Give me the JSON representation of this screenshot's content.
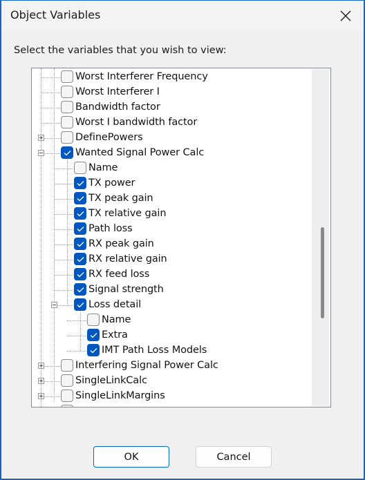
{
  "window": {
    "title": "Object Variables",
    "close_icon": "close-x-icon"
  },
  "prompt": "Select the variables that you wish to view:",
  "tree": {
    "rows": [
      {
        "label": "Worst Interferer Frequency",
        "level": 1,
        "checked": false,
        "expander": null
      },
      {
        "label": "Worst Interferer I",
        "level": 1,
        "checked": false,
        "expander": null
      },
      {
        "label": "Bandwidth factor",
        "level": 1,
        "checked": false,
        "expander": null
      },
      {
        "label": "Worst I bandwidth factor",
        "level": 1,
        "checked": false,
        "expander": null
      },
      {
        "label": "DefinePowers",
        "level": 1,
        "checked": false,
        "expander": "plus"
      },
      {
        "label": "Wanted Signal Power Calc",
        "level": 1,
        "checked": true,
        "expander": "minus"
      },
      {
        "label": "Name",
        "level": 2,
        "checked": false,
        "expander": null
      },
      {
        "label": "TX power",
        "level": 2,
        "checked": true,
        "expander": null
      },
      {
        "label": "TX peak gain",
        "level": 2,
        "checked": true,
        "expander": null
      },
      {
        "label": "TX relative gain",
        "level": 2,
        "checked": true,
        "expander": null
      },
      {
        "label": "Path loss",
        "level": 2,
        "checked": true,
        "expander": null
      },
      {
        "label": "RX peak gain",
        "level": 2,
        "checked": true,
        "expander": null
      },
      {
        "label": "RX relative gain",
        "level": 2,
        "checked": true,
        "expander": null
      },
      {
        "label": "RX feed loss",
        "level": 2,
        "checked": true,
        "expander": null
      },
      {
        "label": "Signal strength",
        "level": 2,
        "checked": true,
        "expander": null
      },
      {
        "label": "Loss detail",
        "level": 2,
        "checked": true,
        "expander": "minus"
      },
      {
        "label": "Name",
        "level": 3,
        "checked": false,
        "expander": null
      },
      {
        "label": "Extra",
        "level": 3,
        "checked": true,
        "expander": null
      },
      {
        "label": "IMT Path Loss Models",
        "level": 3,
        "checked": true,
        "expander": null
      },
      {
        "label": "Interfering Signal Power Calc",
        "level": 1,
        "checked": false,
        "expander": "plus"
      },
      {
        "label": "SingleLinkCalc",
        "level": 1,
        "checked": false,
        "expander": "plus"
      },
      {
        "label": "SingleLinkMargins",
        "level": 1,
        "checked": false,
        "expander": "plus"
      },
      {
        "label": "",
        "level": 1,
        "checked": false,
        "expander": null
      }
    ],
    "scrollbar": {
      "thumb_start_fraction": 0.47,
      "thumb_size_fraction": 0.27
    }
  },
  "buttons": {
    "ok": "OK",
    "cancel": "Cancel"
  },
  "colors": {
    "accent": "#0057c0",
    "window_border": "#1565c8"
  }
}
